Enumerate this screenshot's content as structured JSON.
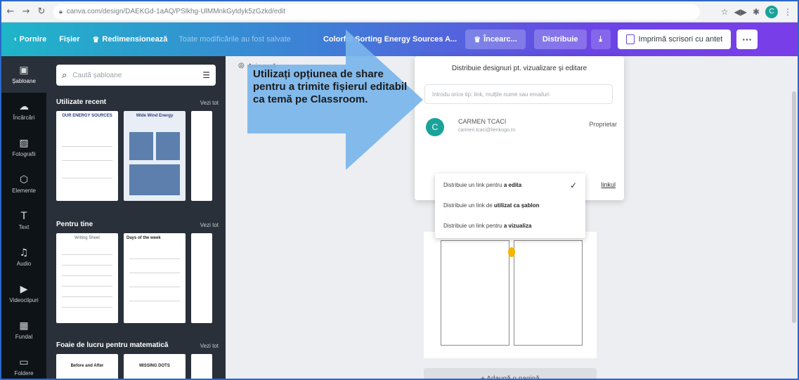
{
  "browser": {
    "url": "canva.com/design/DAEKGd-1aAQ/PSlkhg-UlMMnkGytdyk5zGzkd/edit",
    "profile_initial": "C",
    "icons": [
      "back-icon",
      "forward-icon",
      "reload-icon",
      "lock-icon",
      "star-icon",
      "extension-icon",
      "puzzle-icon",
      "menu-icon"
    ]
  },
  "toolbar": {
    "home_label": "Pornire",
    "file_label": "Fișier",
    "resize_label": "Redimensionează",
    "saved_status": "Toate modificările au fost salvate",
    "design_title": "Colorful Sorting Energy Sources A...",
    "upgrade_label": "Încearc...",
    "share_label": "Distribuie",
    "print_label": "Imprimă scrisori cu antet",
    "more_label": "···"
  },
  "rail": {
    "items": [
      {
        "label": "Șabloane",
        "icon": "template-icon",
        "glyph": "▣"
      },
      {
        "label": "Încărcări",
        "icon": "upload-icon",
        "glyph": "☁"
      },
      {
        "label": "Fotografii",
        "icon": "photo-icon",
        "glyph": "▨"
      },
      {
        "label": "Elemente",
        "icon": "elements-icon",
        "glyph": "⬡"
      },
      {
        "label": "Text",
        "icon": "text-icon",
        "glyph": "T"
      },
      {
        "label": "Audio",
        "icon": "audio-icon",
        "glyph": "♫"
      },
      {
        "label": "Videoclipuri",
        "icon": "video-icon",
        "glyph": "▶"
      },
      {
        "label": "Fundal",
        "icon": "background-icon",
        "glyph": "▦"
      },
      {
        "label": "Foldere",
        "icon": "folder-icon",
        "glyph": "▭"
      }
    ]
  },
  "panel": {
    "search_placeholder": "Caută șabloane",
    "sections": [
      {
        "title": "Utilizate recent",
        "see_all": "Vezi tot"
      },
      {
        "title": "Pentru tine",
        "see_all": "Vezi tot"
      },
      {
        "title": "Foaie de lucru pentru matematică",
        "see_all": "Vezi tot"
      }
    ],
    "thumbs": {
      "recent_1_title": "OUR ENERGY SOURCES",
      "recent_2_title": "Wide Wind Energy",
      "foryou_1_title": "Writing Sheet",
      "foryou_2_title": "Days of the week",
      "math_1_title": "Before and After",
      "math_2_title": "MISSING DOTS"
    }
  },
  "canvas": {
    "animate_label": "Animează",
    "add_page_label": "+ Adaugă o pagină"
  },
  "share": {
    "title": "Distribuie designuri pt. vizualizare și editare",
    "input_placeholder": "Introdu orice tip: link, mulțile nume sau emailuri",
    "user_initial": "C",
    "user_name": "CARMEN TCACI",
    "user_email": "carmen.tcaci@lienkogo.ro",
    "user_role": "Proprietar",
    "copy_link": "linkul"
  },
  "dropdown": {
    "items": [
      {
        "prefix": "Distribuie un link pentru ",
        "bold": "a edita"
      },
      {
        "prefix": "Distribuie un link de ",
        "bold": "utilizat ca șablon"
      },
      {
        "prefix": "Distribuie un link pentru ",
        "bold": "a vizualiza"
      }
    ],
    "selected_check": "✓"
  },
  "annotation": {
    "text": "Utilizați opțiunea de share pentru a trimite fișierul editabil ca temă pe Classroom."
  },
  "colors": {
    "toolbar_start": "#1fb5c9",
    "toolbar_end": "#7a3ee8",
    "rail": "#0e1318",
    "panel": "#293039",
    "arrow": "#79b5ec",
    "avatar": "#1aa39a"
  }
}
